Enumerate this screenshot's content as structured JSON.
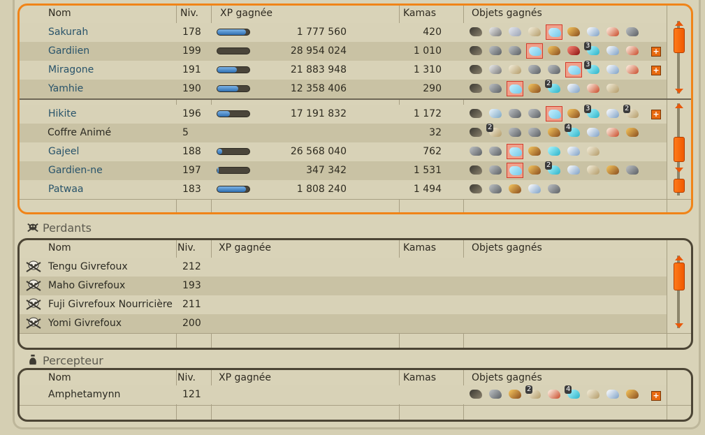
{
  "headers": {
    "name": "Nom",
    "level": "Niv.",
    "xp": "XP gagnée",
    "kamas": "Kamas",
    "items": "Objets gagnés"
  },
  "winners": [
    {
      "name": "Sakurah",
      "level": "178",
      "xp": "1 777 560",
      "xp_fill": 0.9,
      "kamas": "420",
      "items": [
        "dark",
        "metal",
        "silver",
        "bone",
        "ghost",
        "chest",
        "wing",
        "shell",
        "rock"
      ],
      "plus": false
    },
    {
      "name": "Gardiien",
      "level": "199",
      "xp": "28 954 024",
      "xp_fill": 0.0,
      "kamas": "1 010",
      "items": [
        "dark",
        "rock",
        "rock",
        "ghost",
        "chest",
        "red",
        "potion",
        "wing",
        "shell"
      ],
      "plus": true
    },
    {
      "name": "Miragone",
      "level": "191",
      "xp": "21 883 948",
      "xp_fill": 0.6,
      "kamas": "1 310",
      "items": [
        "dark",
        "metal",
        "bone",
        "rock",
        "rock",
        "ghost",
        "potion",
        "wing",
        "shell"
      ],
      "plus": true
    },
    {
      "name": "Yamhie",
      "level": "190",
      "xp": "12 358 406",
      "xp_fill": 0.65,
      "kamas": "290",
      "items": [
        "dark",
        "rock",
        "ghost",
        "chest",
        "potion",
        "wing",
        "shell",
        "bone"
      ],
      "plus": false
    },
    {
      "name": "Hikite",
      "level": "196",
      "xp": "17 191 832",
      "xp_fill": 0.4,
      "kamas": "1 172",
      "items": [
        "dark",
        "shield",
        "rock",
        "rock",
        "ghost",
        "chest",
        "potion",
        "wing",
        "bone"
      ],
      "plus": true
    },
    {
      "name": "Coffre Animé",
      "level": "5",
      "xp": "",
      "xp_fill": null,
      "kamas": "32",
      "items": [
        "dark",
        "bone",
        "rock",
        "rock",
        "chest",
        "potion",
        "wing",
        "shell",
        "chest"
      ],
      "plus": false
    },
    {
      "name": "Gajeel",
      "level": "188",
      "xp": "26 568 040",
      "xp_fill": 0.15,
      "kamas": "762",
      "items": [
        "rock",
        "rock",
        "ghost",
        "chest",
        "potion",
        "wing",
        "bone"
      ],
      "plus": false
    },
    {
      "name": "Gardien-ne",
      "level": "197",
      "xp": "347 342",
      "xp_fill": 0.05,
      "kamas": "1 531",
      "items": [
        "dark",
        "rock",
        "ghost",
        "chest",
        "potion",
        "wing",
        "bone",
        "chest",
        "rock"
      ],
      "plus": false
    },
    {
      "name": "Patwaa",
      "level": "183",
      "xp": "1 808 240",
      "xp_fill": 0.9,
      "kamas": "1 494",
      "items": [
        "dark",
        "rock",
        "chest",
        "wing",
        "rock"
      ],
      "plus": false
    }
  ],
  "counts": {
    "Yamhie_potion": "2",
    "Gardiien_potion": "3",
    "Miragone_potion": "3",
    "Hikite_potion": "3",
    "Hikite_bone": "2",
    "Coffre_bone": "2",
    "Coffre_potion": "4",
    "Gardien_potion": "2",
    "Percepteur_bone": "2",
    "Percepteur_potion": "4"
  },
  "losers_title": "Perdants",
  "losers": [
    {
      "name": "Tengu Givrefoux",
      "level": "212"
    },
    {
      "name": "Maho Givrefoux",
      "level": "193"
    },
    {
      "name": "Fuji Givrefoux Nourricière",
      "level": "211"
    },
    {
      "name": "Yomi Givrefoux",
      "level": "200"
    }
  ],
  "collector_title": "Percepteur",
  "collector": {
    "name": "Amphetamynn",
    "level": "121",
    "items": [
      "dark",
      "rock",
      "chest",
      "bone",
      "shell",
      "potion",
      "bone",
      "wing",
      "chest"
    ],
    "plus": true
  },
  "colors": {
    "accent": "#f08418",
    "link": "#28536a",
    "bar": "#2f6fb1"
  }
}
